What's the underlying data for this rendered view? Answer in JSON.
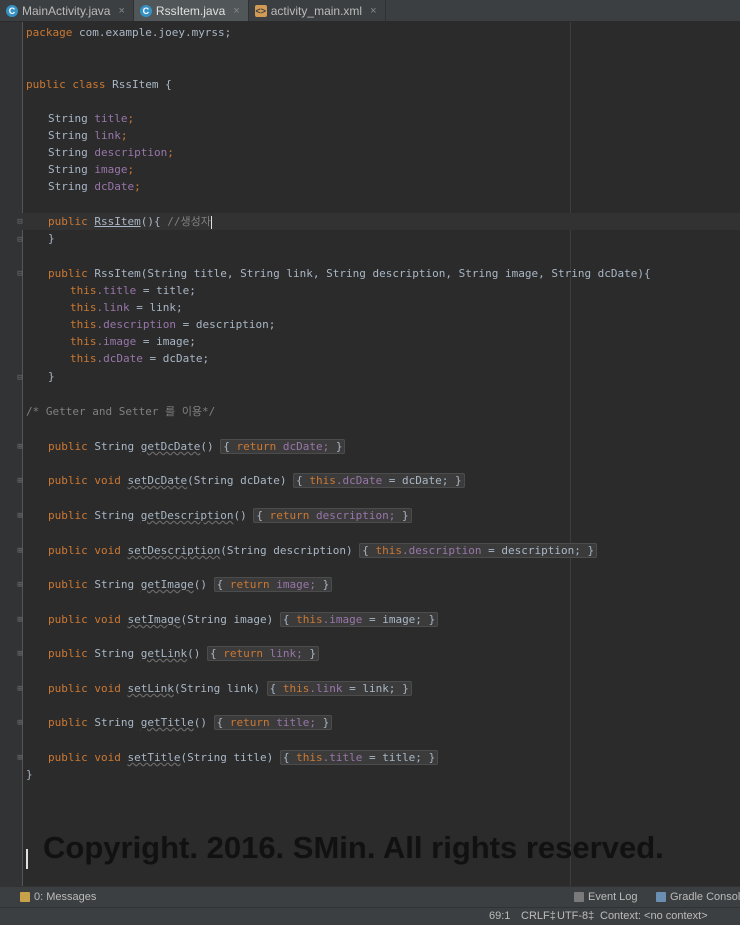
{
  "tabs": [
    {
      "label": "MainActivity.java",
      "icon": "class-icon",
      "close": "×"
    },
    {
      "label": "RssItem.java",
      "icon": "class-icon",
      "close": "×"
    },
    {
      "label": "activity_main.xml",
      "icon": "xml-layout-icon",
      "close": "×"
    }
  ],
  "editor": {
    "language": "java",
    "code": {
      "l1_pkg_kw": "package",
      "l1_pkg": " com.example.joey.myrss;",
      "l2_kw": "public class",
      "l2_rest": " RssItem {",
      "f_type": "String",
      "f1": "title",
      "f2": "link",
      "f3": "description",
      "f4": "image",
      "f5": "dcDate",
      "semi": ";",
      "ctor1_kw": "public",
      "ctor1_name": "RssItem",
      "ctor1_rest": "(){ ",
      "ctor1_comment": "//생성자",
      "close_brace": "}",
      "ctor2_kw": "public",
      "ctor2_rest": " RssItem(String title, String link, String description, String image, String dcDate){",
      "this_kw": "this",
      "a1_f": ".title",
      "a1_r": " = title;",
      "a2_f": ".link",
      "a2_r": " = link;",
      "a3_f": ".description",
      "a3_r": " = description;",
      "a4_f": ".image",
      "a4_r": " = image;",
      "a5_f": ".dcDate",
      "a5_r": " = dcDate;",
      "comment_gs": "/* Getter and Setter 를 이용*/",
      "m_public": "public",
      "m_void": "void",
      "m1_sig": " String ",
      "m1_name": "getDcDate",
      "m1_args": "() ",
      "m_ret": "return",
      "m1_body": " dcDate;",
      "m2_name": "setDcDate",
      "m2_args": "(String dcDate) ",
      "m2_f": ".dcDate",
      "m2_r": " = dcDate;",
      "m3_name": "getDescription",
      "m3_body": " description;",
      "m4_name": "setDescription",
      "m4_args": "(String description) ",
      "m4_f": ".description",
      "m4_r": " = description;",
      "m5_name": "getImage",
      "m5_body": " image;",
      "m6_name": "setImage",
      "m6_args": "(String image) ",
      "m6_f": ".image",
      "m6_r": " = image;",
      "m7_name": "getLink",
      "m7_body": " link;",
      "m8_name": "setLink",
      "m8_args": "(String link) ",
      "m8_f": ".link",
      "m8_r": " = link;",
      "m9_name": "getTitle",
      "m9_body": " title;",
      "m10_name": "setTitle",
      "m10_args": "(String title) ",
      "m10_f": ".title",
      "m10_r": " = title;",
      "lbrace": "{",
      "rbrace": "}",
      "sp": " "
    }
  },
  "watermark": "Copyright. 2016. SMin. All rights reserved.",
  "toolwindows": {
    "messages": "0: Messages",
    "event_log": "Event Log",
    "gradle_console": "Gradle Console"
  },
  "status": {
    "position": "69:1",
    "line_sep": "CRLF‡",
    "encoding": "UTF-8‡",
    "context": "Context: <no context>"
  },
  "colors": {
    "background": "#2b2b2b",
    "keyword": "#cc7832",
    "field": "#9876aa",
    "text": "#a9b7c6",
    "comment": "#808080"
  }
}
